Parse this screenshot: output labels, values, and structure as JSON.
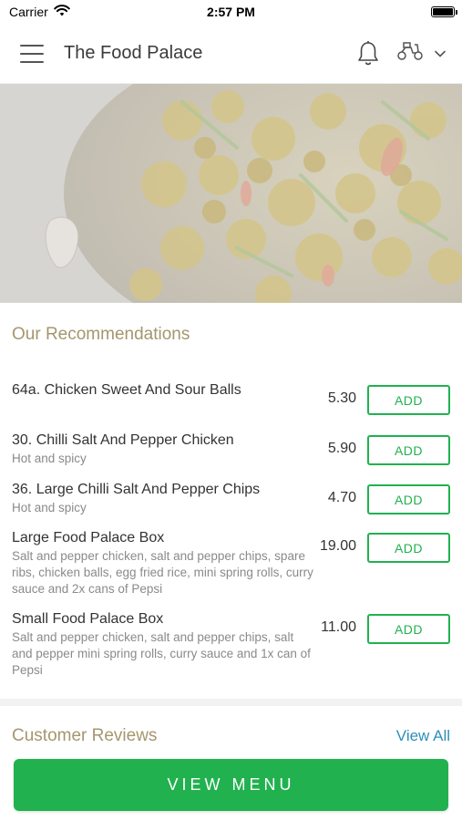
{
  "status_bar": {
    "carrier": "Carrier",
    "time": "2:57 PM"
  },
  "header": {
    "title": "The Food Palace",
    "icons": [
      "menu-icon",
      "bell-icon",
      "scooter-icon",
      "chevron-down-icon"
    ]
  },
  "recommendations": {
    "title": "Our Recommendations",
    "add_label": "ADD",
    "items": [
      {
        "name": "64a. Chicken Sweet And Sour Balls",
        "description": "",
        "price": "5.30"
      },
      {
        "name": "30. Chilli Salt And Pepper Chicken",
        "description": "Hot and spicy",
        "price": "5.90"
      },
      {
        "name": "36. Large Chilli Salt And Pepper Chips",
        "description": "Hot and spicy",
        "price": "4.70"
      },
      {
        "name": "Large Food Palace Box",
        "description": "Salt and pepper chicken, salt and pepper chips, spare ribs, chicken balls, egg fried rice, mini spring rolls, curry sauce and 2x cans of Pepsi",
        "price": "19.00"
      },
      {
        "name": "Small Food Palace Box",
        "description": "Salt and pepper chicken, salt and pepper chips, salt and pepper mini spring rolls, curry sauce and 1x can of Pepsi",
        "price": "11.00"
      }
    ]
  },
  "reviews": {
    "title": "Customer Reviews",
    "view_all": "View All"
  },
  "cta": {
    "view_menu": "VIEW MENU"
  },
  "colors": {
    "accent_green": "#21b14f",
    "section_gold": "#a4966e",
    "link_blue": "#2d8fb8"
  }
}
